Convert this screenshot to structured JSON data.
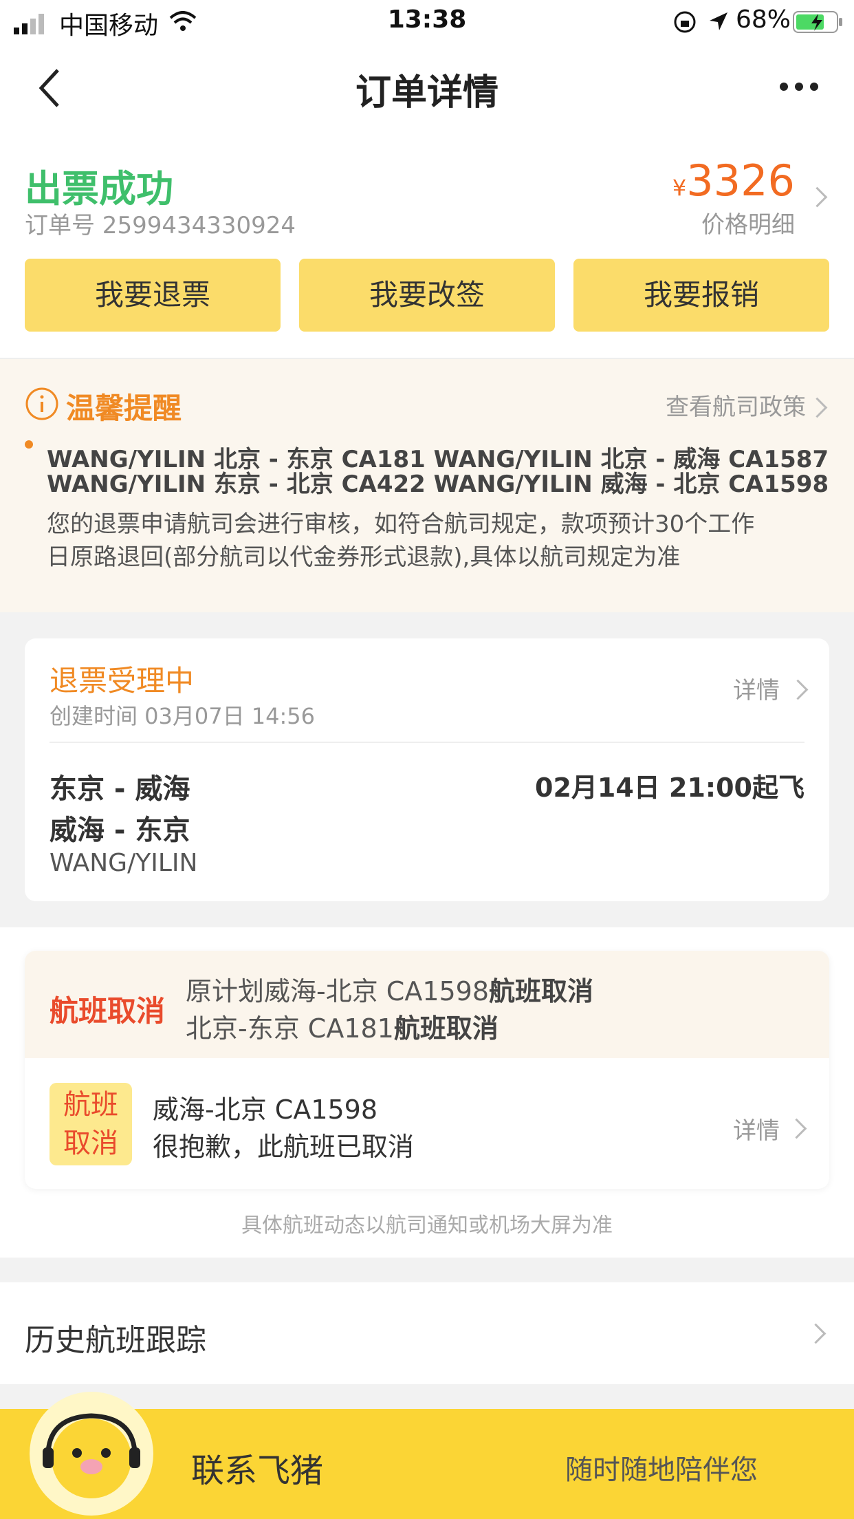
{
  "status_bar": {
    "carrier": "中国移动",
    "time": "13:38",
    "battery": "68%"
  },
  "nav": {
    "title": "订单详情"
  },
  "order": {
    "status": "出票成功",
    "order_no": "订单号 2599434330924",
    "price_symbol": "¥",
    "price": "3326",
    "price_detail": "价格明细",
    "buttons": [
      "我要退票",
      "我要改签",
      "我要报销"
    ]
  },
  "tips": {
    "title": "温馨提醒",
    "link": "查看航司政策",
    "lines": [
      "WANG/YILIN 北京 - 东京 CA181 WANG/YILIN 北京 - 威海 CA1587",
      "WANG/YILIN 东京 - 北京 CA422 WANG/YILIN 威海 - 北京 CA1598"
    ],
    "body": [
      "您的退票申请航司会进行审核，如符合航司规定，款项预计30个工作",
      "日原路退回(部分航司以代金券形式退款),具体以航司规定为准"
    ]
  },
  "refund": {
    "title": "退票受理中",
    "created": "创建时间 03月07日 14:56",
    "link": "详情",
    "routes": [
      "东京 - 威海",
      "威海 - 东京"
    ],
    "depart": "02月14日 21:00起飞",
    "passenger": "WANG/YILIN"
  },
  "cancel": {
    "label": "航班取消",
    "line1_prefix": "原计划威海-北京 CA1598",
    "line1_suffix": "航班取消",
    "line2_prefix": "北京-东京 CA181",
    "line2_suffix": "航班取消",
    "badge_1": "航班",
    "badge_2": "取消",
    "flight": "威海-北京 CA1598",
    "message": "很抱歉，此航班已取消",
    "link": "详情",
    "footnote": "具体航班动态以航司通知或机场大屏为准"
  },
  "history": {
    "label": "历史航班跟踪"
  },
  "bottom": {
    "contact": "联系飞猪",
    "slogan": "随时随地陪伴您"
  },
  "colors": {
    "accent_yellow": "#fbdc6a",
    "success_green": "#3fbf6b",
    "price_orange": "#f26b22",
    "cancel_red": "#e94b2c"
  }
}
